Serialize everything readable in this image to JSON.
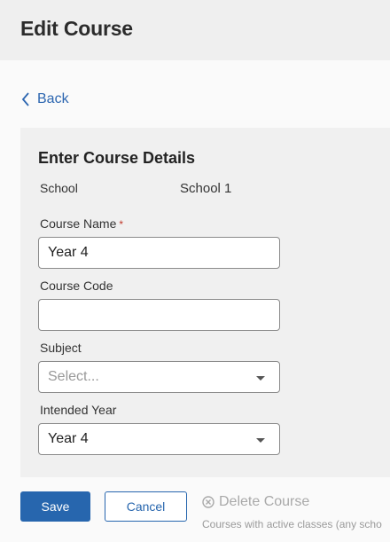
{
  "header": {
    "title": "Edit Course"
  },
  "nav": {
    "back_label": "Back"
  },
  "form": {
    "title": "Enter Course Details",
    "school_label": "School",
    "school_value": "School 1",
    "course_name": {
      "label": "Course Name",
      "required_mark": "*",
      "value": "Year 4"
    },
    "course_code": {
      "label": "Course Code",
      "value": ""
    },
    "subject": {
      "label": "Subject",
      "placeholder": "Select..."
    },
    "intended_year": {
      "label": "Intended Year",
      "value": "Year 4"
    }
  },
  "actions": {
    "save_label": "Save",
    "cancel_label": "Cancel",
    "delete_label": "Delete Course",
    "delete_note": "Courses with active classes (any scho"
  },
  "colors": {
    "primary": "#2766ae",
    "link": "#2c66b0",
    "disabled": "#a9a9a9"
  },
  "icons": {
    "back": "chevron-left-icon",
    "delete": "circle-x-icon",
    "dropdown": "caret-down-icon"
  }
}
